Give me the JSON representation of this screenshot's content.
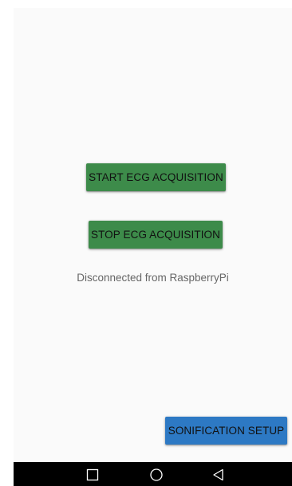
{
  "main": {
    "start_button_label": "START ECG ACQUISITION",
    "stop_button_label": "STOP ECG ACQUISITION",
    "status_text": "Disconnected from RaspberryPi",
    "setup_button_label": "SONIFICATION SETUP"
  },
  "colors": {
    "start_button": "#3d8b4a",
    "stop_button": "#3d8b4a",
    "setup_button": "#2d79c4",
    "background": "#fafafa",
    "nav_bar": "#000000"
  },
  "nav_bar": {
    "icons": [
      "recent-apps-icon",
      "home-icon",
      "back-icon"
    ]
  }
}
